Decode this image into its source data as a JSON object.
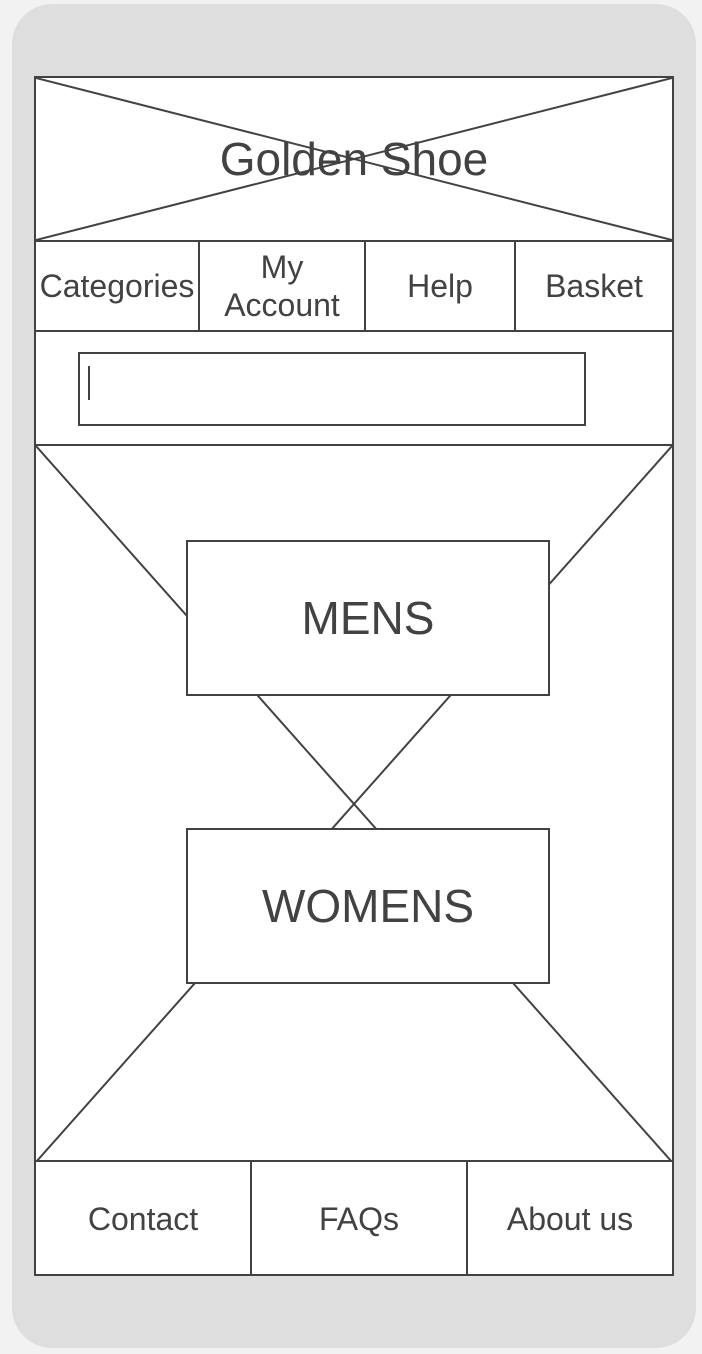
{
  "app": {
    "title": "Golden Shoe"
  },
  "nav": {
    "items": [
      {
        "label": "Categories"
      },
      {
        "label": "My Account"
      },
      {
        "label": "Help"
      },
      {
        "label": "Basket"
      }
    ]
  },
  "search": {
    "value": "",
    "placeholder": ""
  },
  "categories": {
    "mens_label": "MENS",
    "womens_label": "WOMENS"
  },
  "footer": {
    "items": [
      {
        "label": "Contact"
      },
      {
        "label": "FAQs"
      },
      {
        "label": "About us"
      }
    ]
  },
  "colors": {
    "stroke": "#424242",
    "phone_frame": "#dedede",
    "screen": "#ffffff"
  }
}
